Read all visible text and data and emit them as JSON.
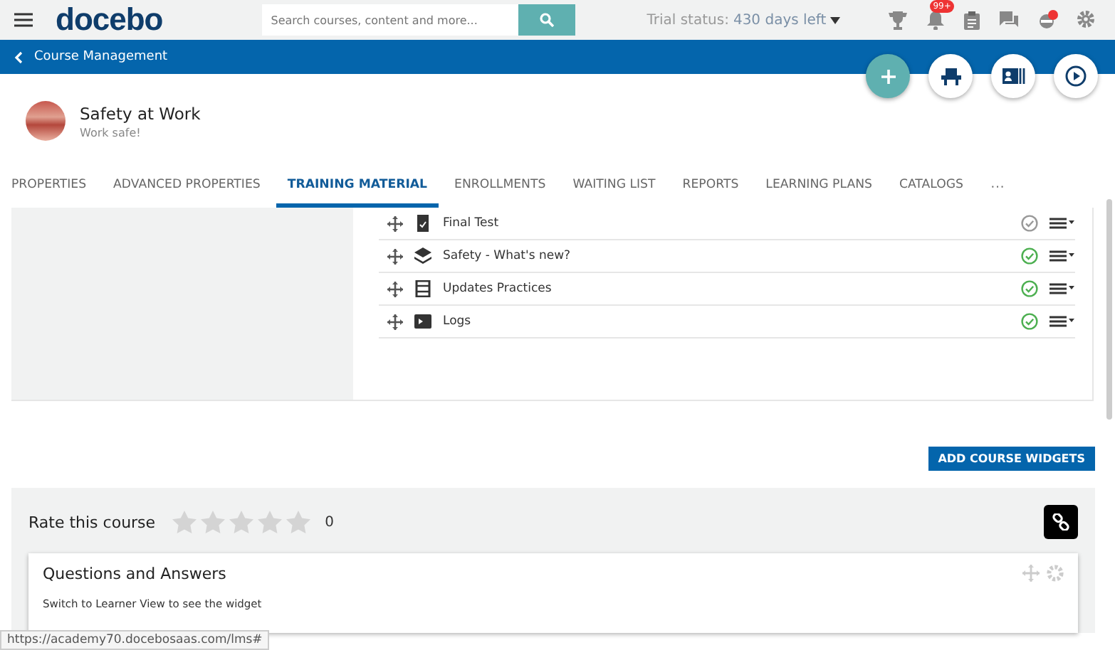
{
  "header": {
    "logo": "docebo",
    "search": {
      "placeholder": "Search courses, content and more..."
    },
    "trial_label": "Trial status:",
    "trial_value": "430 days left",
    "notifications_badge": "99+"
  },
  "nav_bar": {
    "back_label": "Course Management"
  },
  "course": {
    "title": "Safety at Work",
    "subtitle": "Work safe!"
  },
  "tabs": [
    {
      "label": "PROPERTIES",
      "selected": false
    },
    {
      "label": "ADVANCED PROPERTIES",
      "selected": false
    },
    {
      "label": "TRAINING MATERIAL",
      "selected": true
    },
    {
      "label": "ENROLLMENTS",
      "selected": false
    },
    {
      "label": "WAITING LIST",
      "selected": false
    },
    {
      "label": "REPORTS",
      "selected": false
    },
    {
      "label": "LEARNING PLANS",
      "selected": false
    },
    {
      "label": "CATALOGS",
      "selected": false
    }
  ],
  "tabs_more": "···",
  "materials": [
    {
      "kind": "test",
      "title": "Final Test",
      "completed": false
    },
    {
      "kind": "layers",
      "title": "Safety - What's new?",
      "completed": true
    },
    {
      "kind": "video",
      "title": "Updates Practices",
      "completed": true
    },
    {
      "kind": "slides",
      "title": "Logs",
      "completed": true
    }
  ],
  "add_widgets_button": "ADD COURSE WIDGETS",
  "rating": {
    "label": "Rate this course",
    "stars": 0,
    "count": "0"
  },
  "widget": {
    "title": "Questions and Answers",
    "message": "Switch to Learner View to see the widget"
  },
  "status_url": "https://academy70.docebosaas.com/lms#"
}
